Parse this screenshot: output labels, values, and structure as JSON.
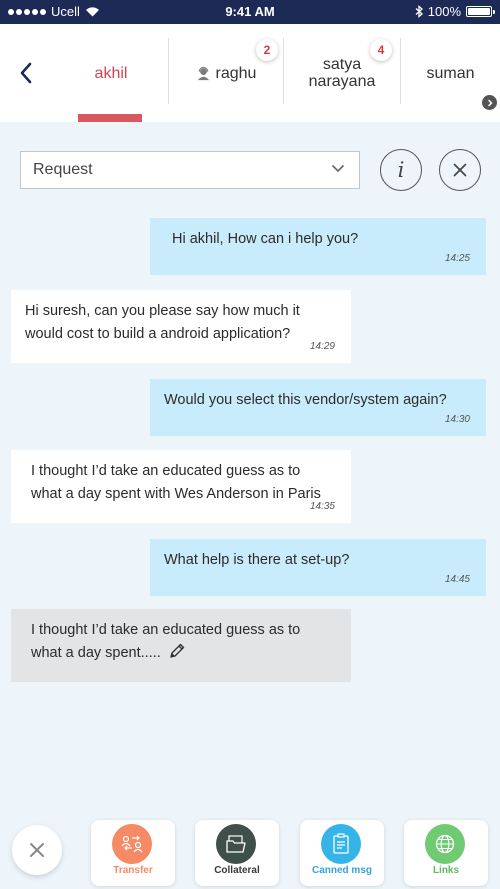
{
  "status_bar": {
    "carrier": "Ucell",
    "time": "9:41 AM",
    "battery_percent": "100%",
    "bluetooth_icon": "bluetooth-icon",
    "wifi_icon": "wifi-icon"
  },
  "header": {
    "back_icon": "chevron-left-icon",
    "tabs": [
      {
        "label": "akhil",
        "active": true,
        "badge": ""
      },
      {
        "label": "raghu",
        "active": false,
        "badge": "2",
        "icon": "agent-icon"
      },
      {
        "label": "satya narayana",
        "active": false,
        "badge": "4"
      },
      {
        "label": "suman",
        "active": false,
        "badge": ""
      }
    ],
    "active_color": "#d3444f"
  },
  "request": {
    "selected": "Request",
    "info_icon": "info-icon",
    "close_icon": "close-icon"
  },
  "messages": [
    {
      "direction": "out",
      "text": "Hi akhil, How can i help you?",
      "time": "14:25"
    },
    {
      "direction": "in",
      "lines": [
        "Hi suresh, can you please say how much it",
        "would cost to build a android application?"
      ],
      "time": "14:29"
    },
    {
      "direction": "out",
      "text": "Would you select this vendor/system again?",
      "time": "14:30"
    },
    {
      "direction": "in",
      "lines": [
        "I thought I’d take an educated guess as to",
        "what a day spent with Wes Anderson in Paris"
      ],
      "time": "14:35"
    },
    {
      "direction": "out",
      "text": "What help is there at set-up?",
      "time": "14:45"
    },
    {
      "direction": "draft",
      "lines": [
        "I thought I’d take an educated guess as to",
        "what a day spent....."
      ],
      "icon": "pencil-icon"
    }
  ],
  "actions": [
    {
      "label": "Transfer",
      "icon": "transfer-icon",
      "color": "#f58a64"
    },
    {
      "label": "Collateral",
      "icon": "folder-icon",
      "color": "#3f4f49"
    },
    {
      "label": "Canned msg",
      "icon": "canned-message-icon",
      "color": "#34b4e8"
    },
    {
      "label": "Links",
      "icon": "globe-icon",
      "color": "#6fca72"
    }
  ],
  "colors": {
    "outgoing_bubble": "#c9ecfc",
    "incoming_bubble": "#ffffff",
    "draft_bubble": "#e3e4e5",
    "status_bar": "#1d2a55"
  }
}
